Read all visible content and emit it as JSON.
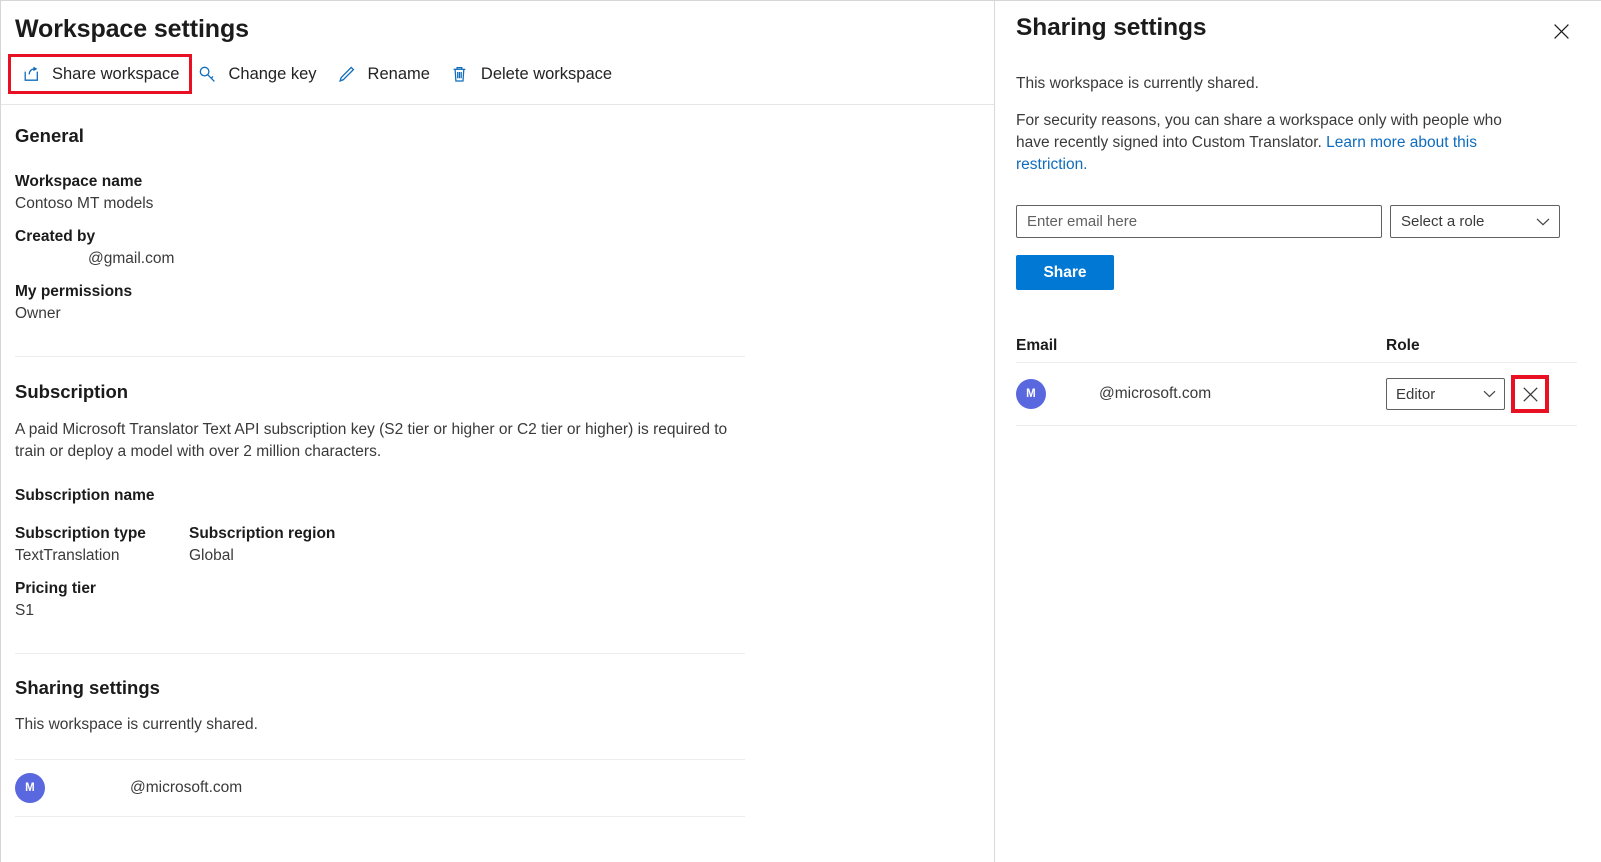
{
  "left": {
    "page_title": "Workspace settings",
    "command_bar": [
      {
        "id": "share-workspace",
        "label": "Share workspace",
        "icon": "share-icon",
        "highlighted": true
      },
      {
        "id": "change-key",
        "label": "Change key",
        "icon": "key-icon",
        "highlighted": false
      },
      {
        "id": "rename",
        "label": "Rename",
        "icon": "pencil-icon",
        "highlighted": false
      },
      {
        "id": "delete-workspace",
        "label": "Delete workspace",
        "icon": "trash-icon",
        "highlighted": false
      }
    ],
    "general": {
      "heading": "General",
      "workspace_name_label": "Workspace name",
      "workspace_name_value": "Contoso MT models",
      "created_by_label": "Created by",
      "created_by_value": "@gmail.com",
      "my_permissions_label": "My permissions",
      "my_permissions_value": "Owner"
    },
    "subscription": {
      "heading": "Subscription",
      "description": "A paid Microsoft Translator Text API subscription key (S2 tier or higher or C2 tier or higher) is required to train or deploy a model with over 2 million characters.",
      "name_label": "Subscription name",
      "name_value": "",
      "type_label": "Subscription type",
      "type_value": "TextTranslation",
      "region_label": "Subscription region",
      "region_value": "Global",
      "pricing_tier_label": "Pricing tier",
      "pricing_tier_value": "S1"
    },
    "sharing": {
      "heading": "Sharing settings",
      "status": "This workspace is currently shared.",
      "members": [
        {
          "initial": "M",
          "email": "@microsoft.com",
          "avatar_color": "#5a68e0"
        }
      ]
    }
  },
  "right": {
    "title": "Sharing settings",
    "close_icon": "close-icon",
    "status": "This workspace is currently shared.",
    "note_text": "For security reasons, you can share a workspace only with people who have recently signed into Custom Translator. ",
    "note_link": "Learn more about this restriction.",
    "email_placeholder": "Enter email here",
    "email_value": "",
    "role_placeholder": "Select a role",
    "share_button_label": "Share",
    "table": {
      "headers": {
        "email": "Email",
        "role": "Role"
      },
      "rows": [
        {
          "initial": "M",
          "avatar_color": "#5a68e0",
          "email": "@microsoft.com",
          "role": "Editor",
          "remove_icon": "close-icon",
          "remove_highlighted": true
        }
      ]
    }
  },
  "colors": {
    "accent": "#0078d4",
    "icon_blue": "#0f6cbd",
    "link": "#0f6cbd",
    "highlight_red": "#e81123",
    "avatar": "#5a68e0"
  }
}
